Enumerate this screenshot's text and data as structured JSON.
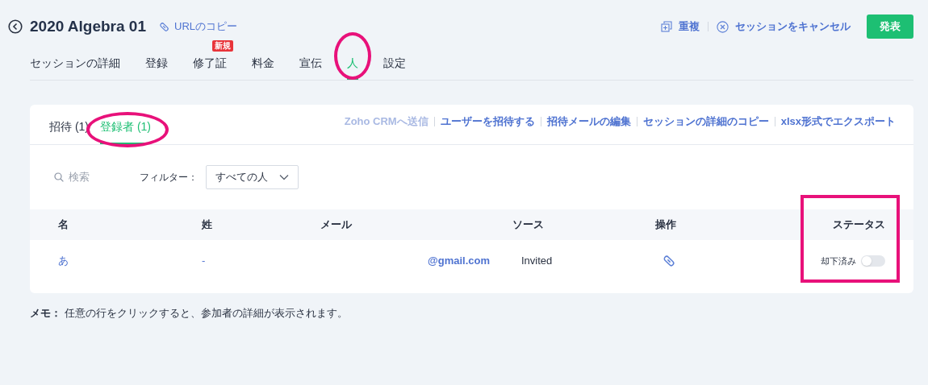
{
  "header": {
    "title": "2020 Algebra 01",
    "copy_url": "URLのコピー",
    "actions": [
      {
        "kind": "duplicate",
        "label": "重複"
      },
      {
        "kind": "cancel",
        "label": "セッションをキャンセル"
      }
    ],
    "publish": "発表"
  },
  "tabs": [
    {
      "label": "セッションの詳細",
      "selected": false,
      "circled": false
    },
    {
      "label": "登録",
      "selected": false,
      "circled": false
    },
    {
      "label": "修了証",
      "selected": false,
      "circled": false,
      "badge": "新規"
    },
    {
      "label": "料金",
      "selected": false,
      "circled": false
    },
    {
      "label": "宣伝",
      "selected": false,
      "circled": false
    },
    {
      "label": "人",
      "selected": true,
      "circled": true
    },
    {
      "label": "設定",
      "selected": false,
      "circled": false
    }
  ],
  "subtabs": [
    {
      "label": "招待 (1)",
      "selected": false,
      "circled": false
    },
    {
      "label": "登録者 (1)",
      "selected": true,
      "circled": true
    }
  ],
  "links": [
    {
      "label": "Zoho CRMへ送信",
      "disabled": true
    },
    {
      "label": "ユーザーを招待する",
      "disabled": false
    },
    {
      "label": "招待メールの編集",
      "disabled": false
    },
    {
      "label": "セッションの詳細のコピー",
      "disabled": false
    },
    {
      "label": "xlsx形式でエクスポート",
      "disabled": false
    }
  ],
  "search": {
    "placeholder": "検索"
  },
  "filter": {
    "label": "フィルター：",
    "value": "すべての人"
  },
  "table": {
    "columns": [
      "名",
      "姓",
      "メール",
      "ソース",
      "操作",
      "ステータス"
    ],
    "status_highlighted": true,
    "rows": [
      {
        "first_name": "あ",
        "last_name": "-",
        "email": "@gmail.com",
        "source": "Invited",
        "status_label": "却下済み",
        "on": false
      }
    ]
  },
  "memo": "**メモ：** 任意の行をクリックすると、参加者の詳細が表示されます。"
}
